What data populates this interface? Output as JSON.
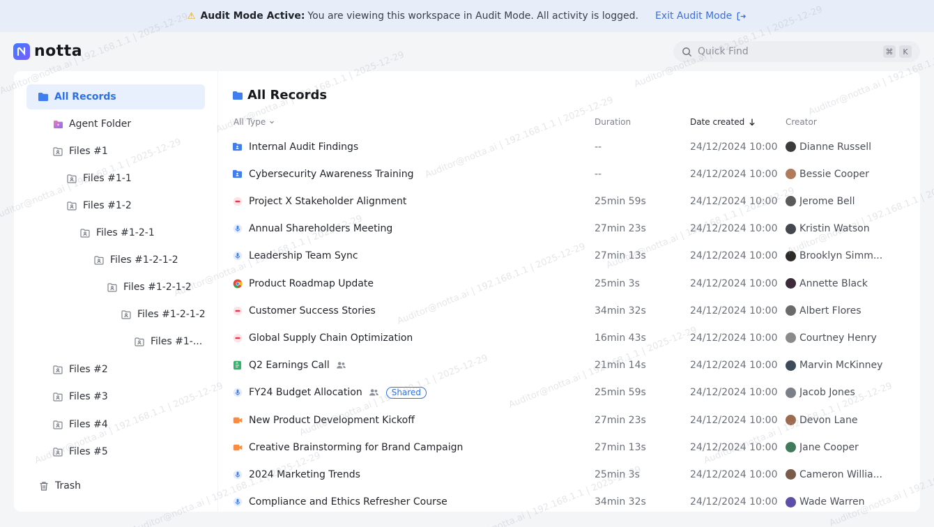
{
  "banner": {
    "title": "Audit Mode Active:",
    "message": "You are viewing this workspace in Audit Mode. All activity is logged.",
    "exit_label": "Exit Audit Mode"
  },
  "logo": {
    "text": "notta"
  },
  "search": {
    "placeholder": "Quick Find",
    "kbd1": "⌘",
    "kbd2": "K"
  },
  "sidebar": {
    "items": [
      {
        "label": "All Records",
        "icon": "folder-icon"
      },
      {
        "label": "Agent Folder",
        "icon": "agent-folder-icon"
      },
      {
        "label": "Files #1",
        "icon": "shared-folder-icon"
      },
      {
        "label": "Files #1-1",
        "icon": "shared-folder-icon"
      },
      {
        "label": "Files #1-2",
        "icon": "shared-folder-icon"
      },
      {
        "label": "Files #1-2-1",
        "icon": "shared-folder-icon"
      },
      {
        "label": "Files #1-2-1-2",
        "icon": "shared-folder-icon"
      },
      {
        "label": "Files #1-2-1-2",
        "icon": "shared-folder-icon"
      },
      {
        "label": "Files #1-2-1-2",
        "icon": "shared-folder-icon"
      },
      {
        "label": "Files #1-...",
        "icon": "shared-folder-icon"
      },
      {
        "label": "Files #2",
        "icon": "shared-folder-icon"
      },
      {
        "label": "Files #3",
        "icon": "shared-folder-icon"
      },
      {
        "label": "Files #4",
        "icon": "shared-folder-icon"
      },
      {
        "label": "Files #5",
        "icon": "shared-folder-icon"
      },
      {
        "label": "Trash",
        "icon": "trash-icon"
      }
    ]
  },
  "main": {
    "title": "All Records",
    "columns": {
      "type": "All Type",
      "duration": "Duration",
      "date": "Date created",
      "creator": "Creator"
    },
    "shared_label": "Shared",
    "rows": [
      {
        "name": "Internal Audit Findings",
        "icon": "folder-icon",
        "duration": "--",
        "date": "24/12/2024 10:00",
        "creator": "Dianne Russell",
        "avatar_color": "#3b3b3b"
      },
      {
        "name": "Cybersecurity Awareness Training",
        "icon": "folder-icon",
        "duration": "--",
        "date": "24/12/2024 10:00",
        "creator": "Bessie Cooper",
        "avatar_color": "#b07a5c"
      },
      {
        "name": "Project X Stakeholder Alignment",
        "icon": "meeting-icon",
        "duration": "25min 59s",
        "date": "24/12/2024 10:00",
        "creator": "Jerome Bell",
        "avatar_color": "#5a5a5a"
      },
      {
        "name": "Annual Shareholders Meeting",
        "icon": "microphone-icon",
        "duration": "27min 23s",
        "date": "24/12/2024 10:00",
        "creator": "Kristin Watson",
        "avatar_color": "#44474d"
      },
      {
        "name": "Leadership Team Sync",
        "icon": "microphone-icon",
        "duration": "27min 13s",
        "date": "24/12/2024 10:00",
        "creator": "Brooklyn Simm...",
        "avatar_color": "#2e2a28"
      },
      {
        "name": "Product Roadmap Update",
        "icon": "chrome-icon",
        "duration": "25min 3s",
        "date": "24/12/2024 10:00",
        "creator": "Annette Black",
        "avatar_color": "#3c2c3a"
      },
      {
        "name": "Customer Success Stories",
        "icon": "meeting-icon",
        "duration": "34min 32s",
        "date": "24/12/2024 10:00",
        "creator": "Albert Flores",
        "avatar_color": "#6a6a6a"
      },
      {
        "name": "Global Supply Chain Optimization",
        "icon": "meeting-icon",
        "duration": "16min 43s",
        "date": "24/12/2024 10:00",
        "creator": "Courtney Henry",
        "avatar_color": "#8a8a8a"
      },
      {
        "name": "Q2 Earnings Call",
        "icon": "document-icon",
        "duration": "21min 14s",
        "date": "24/12/2024 10:00",
        "creator": "Marvin McKinney",
        "avatar_color": "#3d4a5a",
        "people": true
      },
      {
        "name": "FY24 Budget Allocation",
        "icon": "microphone-icon",
        "duration": "25min 59s",
        "date": "24/12/2024 10:00",
        "creator": "Jacob Jones",
        "avatar_color": "#7a7f88",
        "people": true,
        "shared": true
      },
      {
        "name": "New Product Development Kickoff",
        "icon": "video-icon",
        "duration": "27min 23s",
        "date": "24/12/2024 10:00",
        "creator": "Devon Lane",
        "avatar_color": "#9c6a4e"
      },
      {
        "name": "Creative Brainstorming for Brand Campaign",
        "icon": "video-icon",
        "duration": "27min 13s",
        "date": "24/12/2024 10:00",
        "creator": "Jane Cooper",
        "avatar_color": "#3f7a5a"
      },
      {
        "name": "2024 Marketing Trends",
        "icon": "microphone-icon",
        "duration": "25min 3s",
        "date": "24/12/2024 10:00",
        "creator": "Cameron Willia...",
        "avatar_color": "#7a5a48"
      },
      {
        "name": "Compliance and Ethics Refresher Course",
        "icon": "microphone-icon",
        "duration": "34min 32s",
        "date": "24/12/2024 10:00",
        "creator": "Wade Warren",
        "avatar_color": "#5b4fa8"
      }
    ]
  },
  "watermark": "Auditor@notta.ai | 192.168.1.1 | 2025-12-29"
}
